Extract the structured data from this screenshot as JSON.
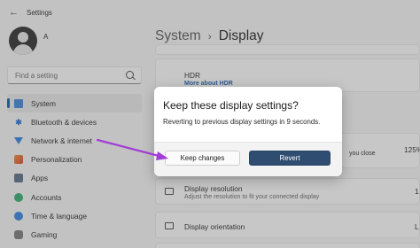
{
  "titlebar": {
    "app_title": "Settings",
    "back_icon": "back-arrow-icon"
  },
  "profile": {
    "name": "A"
  },
  "search": {
    "placeholder": "Find a setting"
  },
  "sidebar": {
    "items": [
      {
        "label": "System",
        "icon": "system-icon"
      },
      {
        "label": "Bluetooth & devices",
        "icon": "bluetooth-icon"
      },
      {
        "label": "Network & internet",
        "icon": "network-icon"
      },
      {
        "label": "Personalization",
        "icon": "personalization-icon"
      },
      {
        "label": "Apps",
        "icon": "apps-icon"
      },
      {
        "label": "Accounts",
        "icon": "accounts-icon"
      },
      {
        "label": "Time & language",
        "icon": "time-language-icon"
      },
      {
        "label": "Gaming",
        "icon": "gaming-icon"
      }
    ],
    "selected": "System"
  },
  "breadcrumb": {
    "parent": "System",
    "separator": "›",
    "current": "Display"
  },
  "main": {
    "hdr": {
      "title": "HDR",
      "link": "More about HDR"
    },
    "scale": {
      "value": "125%",
      "partial_text": "you close"
    },
    "resolution": {
      "title": "Display resolution",
      "subtitle": "Adjust the resolution to fit your connected display",
      "value": "1"
    },
    "orientation": {
      "title": "Display orientation",
      "value": "L"
    }
  },
  "dialog": {
    "title": "Keep these display settings?",
    "body": "Reverting to previous display settings in  9 seconds.",
    "keep_label": "Keep changes",
    "revert_label": "Revert"
  },
  "colors": {
    "accent": "#005fb8",
    "revert_button": "#2e4d70",
    "annotation_arrow": "#a23dd6"
  }
}
